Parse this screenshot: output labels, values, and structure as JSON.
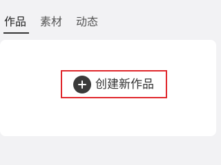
{
  "tabs": [
    {
      "label": "作品",
      "active": true
    },
    {
      "label": "素材",
      "active": false
    },
    {
      "label": "动态",
      "active": false
    }
  ],
  "main": {
    "create_button": {
      "label": "创建新作品",
      "icon": "plus-circle-icon"
    }
  },
  "colors": {
    "background": "#f2f2f4",
    "card": "#ffffff",
    "highlight_border": "#e0262b",
    "icon_fill": "#3a3a3a",
    "text": "#333333"
  }
}
